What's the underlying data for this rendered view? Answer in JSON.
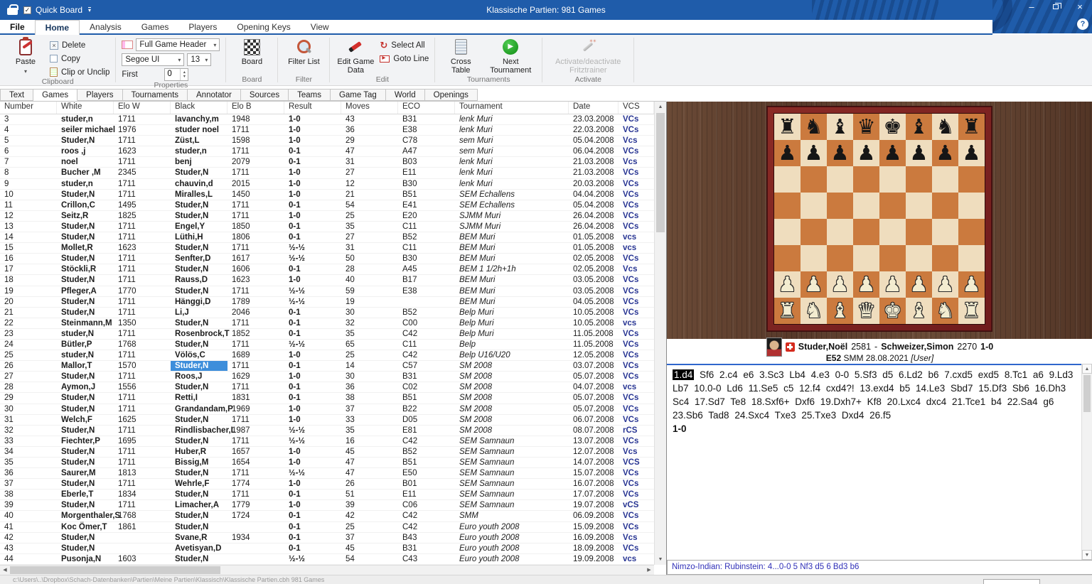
{
  "window": {
    "quick_board": "Quick Board",
    "center_title": "Klassische Partien:  981 Games",
    "minimize": "–",
    "close": "×",
    "help": "?"
  },
  "menu": {
    "file": "File",
    "tabs": [
      "Home",
      "Analysis",
      "Games",
      "Players",
      "Opening Keys",
      "View"
    ],
    "active": "Home"
  },
  "ribbon": {
    "paste": "Paste",
    "delete": "Delete",
    "copy": "Copy",
    "clip_or_unclip": "Clip or Unclip",
    "clipboard_label": "Clipboard",
    "full_game_header": "Full Game Header",
    "font_name": "Segoe UI",
    "font_size": "13",
    "first_label": "First",
    "first_value": "0",
    "properties_label": "Properties",
    "board_btn": "Board",
    "board_label": "Board",
    "filter_list": "Filter List",
    "filter_label": "Filter",
    "edit_game_data": "Edit Game Data",
    "select_all": "Select All",
    "goto_line": "Goto Line",
    "edit_label": "Edit",
    "cross_table": "Cross Table",
    "next_tournament": "Next Tournament",
    "tournaments_label": "Tournaments",
    "fritztrainer": "Activate/deactivate Fritztrainer",
    "activate_label": "Activate"
  },
  "view_tabs": {
    "items": [
      "Text",
      "Games",
      "Players",
      "Tournaments",
      "Annotator",
      "Sources",
      "Teams",
      "Game Tag",
      "World",
      "Openings"
    ],
    "active": "Games"
  },
  "table": {
    "columns": [
      "Number",
      "White",
      "Elo W",
      "Black",
      "Elo B",
      "Result",
      "Moves",
      "ECO",
      "Tournament",
      "Date",
      "VCS"
    ],
    "selected": {
      "row": "26",
      "col": 3
    },
    "rows": [
      [
        "3",
        "studer,n",
        "1711",
        "lavanchy,m",
        "1948",
        "1-0",
        "43",
        "B31",
        "lenk Muri",
        "23.03.2008",
        "VCs"
      ],
      [
        "4",
        "seiler michael",
        "1976",
        "studer noel",
        "1711",
        "1-0",
        "36",
        "E38",
        "lenk Muri",
        "22.03.2008",
        "VCs"
      ],
      [
        "5",
        "Studer,N",
        "1711",
        "Züst,L",
        "1598",
        "1-0",
        "29",
        "C78",
        "sem Muri",
        "05.04.2008",
        "Vcs"
      ],
      [
        "6",
        "roos ,j",
        "1623",
        "studer,n",
        "1711",
        "0-1",
        "47",
        "A47",
        "sem Muri",
        "06.04.2008",
        "VCs"
      ],
      [
        "7",
        "noel",
        "1711",
        "benj",
        "2079",
        "0-1",
        "31",
        "B03",
        "lenk Muri",
        "21.03.2008",
        "Vcs"
      ],
      [
        "8",
        "Bucher ,M",
        "2345",
        "Studer,N",
        "1711",
        "1-0",
        "27",
        "E11",
        "lenk Muri",
        "21.03.2008",
        "VCs"
      ],
      [
        "9",
        "studer,n",
        "1711",
        "chauvin,d",
        "2015",
        "1-0",
        "12",
        "B30",
        "lenk Muri",
        "20.03.2008",
        "VCs"
      ],
      [
        "10",
        "Studer,N",
        "1711",
        "Miralles,L",
        "1450",
        "1-0",
        "21",
        "B51",
        "SEM Echallens",
        "04.04.2008",
        "VCs"
      ],
      [
        "11",
        "Crillon,C",
        "1495",
        "Studer,N",
        "1711",
        "0-1",
        "54",
        "E41",
        "SEM Echallens",
        "05.04.2008",
        "VCs"
      ],
      [
        "12",
        "Seitz,R",
        "1825",
        "Studer,N",
        "1711",
        "1-0",
        "25",
        "E20",
        "SJMM Muri",
        "26.04.2008",
        "VCs"
      ],
      [
        "13",
        "Studer,N",
        "1711",
        "Engel,Y",
        "1850",
        "0-1",
        "35",
        "C11",
        "SJMM Muri",
        "26.04.2008",
        "VCs"
      ],
      [
        "14",
        "Studer,N",
        "1711",
        "Lüthi,H",
        "1806",
        "0-1",
        "27",
        "B52",
        "BEM Muri",
        "01.05.2008",
        "vcs"
      ],
      [
        "15",
        "Mollet,R",
        "1623",
        "Studer,N",
        "1711",
        "½-½",
        "31",
        "C11",
        "BEM Muri",
        "01.05.2008",
        "vcs"
      ],
      [
        "16",
        "Studer,N",
        "1711",
        "Senfter,D",
        "1617",
        "½-½",
        "50",
        "B30",
        "BEM Muri",
        "02.05.2008",
        "VCs"
      ],
      [
        "17",
        "Stöckli,R",
        "1711",
        "Studer,N",
        "1606",
        "0-1",
        "28",
        "A45",
        "BEM 1 1/2h+1h",
        "02.05.2008",
        "Vcs"
      ],
      [
        "18",
        "Studer,N",
        "1711",
        "Rauss,D",
        "1623",
        "1-0",
        "40",
        "B17",
        "BEM Muri",
        "03.05.2008",
        "VCs"
      ],
      [
        "19",
        "Pfleger,A",
        "1770",
        "Studer,N",
        "1711",
        "½-½",
        "59",
        "E38",
        "BEM Muri",
        "03.05.2008",
        "VCs"
      ],
      [
        "20",
        "Studer,N",
        "1711",
        "Hänggi,D",
        "1789",
        "½-½",
        "19",
        "",
        "BEM Muri",
        "04.05.2008",
        "VCs"
      ],
      [
        "21",
        "Studer,N",
        "1711",
        "Li,J",
        "2046",
        "0-1",
        "30",
        "B52",
        "Belp Muri",
        "10.05.2008",
        "VCs"
      ],
      [
        "22",
        "Steinmann,M",
        "1350",
        "Studer,N",
        "1711",
        "0-1",
        "32",
        "C00",
        "Belp Muri",
        "10.05.2008",
        "vcs"
      ],
      [
        "23",
        "studer,N",
        "1711",
        "Rosenbrock,T",
        "1852",
        "0-1",
        "35",
        "C42",
        "Belp Muri",
        "11.05.2008",
        "VCs"
      ],
      [
        "24",
        "Bütler,P",
        "1768",
        "Studer,N",
        "1711",
        "½-½",
        "65",
        "C11",
        "Belp",
        "11.05.2008",
        "VCs"
      ],
      [
        "25",
        "studer,N",
        "1711",
        "Völös,C",
        "1689",
        "1-0",
        "25",
        "C42",
        "Belp U16/U20",
        "12.05.2008",
        "VCs"
      ],
      [
        "26",
        "Mallor,T",
        "1570",
        "Studer,N",
        "1711",
        "0-1",
        "14",
        "C57",
        "SM 2008",
        "03.07.2008",
        "VCs"
      ],
      [
        "27",
        "Studer,N",
        "1711",
        "Roos,J",
        "1629",
        "1-0",
        "30",
        "B31",
        "SM 2008",
        "05.07.2008",
        "VCs"
      ],
      [
        "28",
        "Aymon,J",
        "1556",
        "Studer,N",
        "1711",
        "0-1",
        "36",
        "C02",
        "SM 2008",
        "04.07.2008",
        "vcs"
      ],
      [
        "29",
        "Studer,N",
        "1711",
        "Retti,I",
        "1831",
        "0-1",
        "38",
        "B51",
        "SM 2008",
        "05.07.2008",
        "VCs"
      ],
      [
        "30",
        "Studer,N",
        "1711",
        "Grandandam,P",
        "1969",
        "1-0",
        "37",
        "B22",
        "SM 2008",
        "05.07.2008",
        "VCs"
      ],
      [
        "31",
        "Welch,F",
        "1625",
        "Studer,N",
        "1711",
        "1-0",
        "33",
        "D05",
        "SM 2008",
        "06.07.2008",
        "VCs"
      ],
      [
        "32",
        "Studer,N",
        "1711",
        "Rindlisbacher,L",
        "1987",
        "½-½",
        "35",
        "E81",
        "SM 2008",
        "08.07.2008",
        "rCS"
      ],
      [
        "33",
        "Fiechter,P",
        "1695",
        "Studer,N",
        "1711",
        "½-½",
        "16",
        "C42",
        "SEM Samnaun",
        "13.07.2008",
        "VCs"
      ],
      [
        "34",
        "Studer,N",
        "1711",
        "Huber,R",
        "1657",
        "1-0",
        "45",
        "B52",
        "SEM Samnaun",
        "12.07.2008",
        "Vcs"
      ],
      [
        "35",
        "Studer,N",
        "1711",
        "Bissig,M",
        "1654",
        "1-0",
        "47",
        "B51",
        "SEM Samnaun",
        "14.07.2008",
        "VCS"
      ],
      [
        "36",
        "Saurer,M",
        "1813",
        "Studer,N",
        "1711",
        "½-½",
        "47",
        "E50",
        "SEM Samnaun",
        "15.07.2008",
        "VCs"
      ],
      [
        "37",
        "Studer,N",
        "1711",
        "Wehrle,F",
        "1774",
        "1-0",
        "26",
        "B01",
        "SEM Samnaun",
        "16.07.2008",
        "VCs"
      ],
      [
        "38",
        "Eberle,T",
        "1834",
        "Studer,N",
        "1711",
        "0-1",
        "51",
        "E11",
        "SEM Samnaun",
        "17.07.2008",
        "VCs"
      ],
      [
        "39",
        "Studer,N",
        "1711",
        "Limacher,A",
        "1779",
        "1-0",
        "39",
        "C06",
        "SEM Samnaun",
        "19.07.2008",
        "vCS"
      ],
      [
        "40",
        "Morgenthaler,S",
        "1768",
        "Studer,N",
        "1724",
        "0-1",
        "42",
        "C42",
        "SMM",
        "06.09.2008",
        "VCs"
      ],
      [
        "41",
        "Koc Ömer,T",
        "1861",
        "Studer,N",
        "",
        "0-1",
        "25",
        "C42",
        "Euro youth 2008",
        "15.09.2008",
        "VCs"
      ],
      [
        "42",
        "Studer,N",
        "",
        "Svane,R",
        "1934",
        "0-1",
        "37",
        "B43",
        "Euro youth 2008",
        "16.09.2008",
        "Vcs"
      ],
      [
        "43",
        "Studer,N",
        "",
        "Avetisyan,D",
        "",
        "0-1",
        "45",
        "B31",
        "Euro youth 2008",
        "18.09.2008",
        "VCs"
      ],
      [
        "44",
        "Pusonja,N",
        "1603",
        "Studer,N",
        "",
        "½-½",
        "54",
        "C43",
        "Euro youth 2008",
        "19.09.2008",
        "vcs"
      ]
    ]
  },
  "board": {
    "rows": [
      "rnbqkbnr",
      "pppppppp",
      "        ",
      "        ",
      "        ",
      "        ",
      "PPPPPPPP",
      "RNBQKBNR"
    ]
  },
  "game": {
    "white": "Studer,Noël",
    "white_elo": "2581",
    "separator": "-",
    "black": "Schweizer,Simon",
    "black_elo": "2270",
    "result": "1-0",
    "eco": "E52",
    "event_date": "SMM 28.08.2021",
    "user": "[User]"
  },
  "notation": {
    "first": "1.d4",
    "moves": "Sf6 2.c4 e6 3.Sc3 Lb4 4.e3 0-0 5.Sf3 d5 6.Ld2 b6 7.cxd5 exd5 8.Tc1 a6 9.Ld3 Lb7 10.0-0 Ld6 11.Se5 c5 12.f4 cxd4?! 13.exd4 b5 14.Le3 Sbd7 15.Df3 Sb6 16.Dh3 Sc4 17.Sd7 Te8 18.Sxf6+ Dxf6 19.Dxh7+ Kf8 20.Lxc4 dxc4 21.Tce1 b4 22.Sa4 g6 23.Sb6 Tad8 24.Sxc4 Txe3 25.Txe3 Dxd4 26.f5",
    "result": "1-0"
  },
  "opening": {
    "text": "Nimzo-Indian: Rubinstein: 4...0-0 5 Nf3 d5 6 Bd3 b6"
  },
  "status": {
    "path": "c:\\Users\\..\\Dropbox\\Schach-Datenbanken\\Partien\\Meine Partien\\Klassisch\\Klassische Partien.cbh  981 Games"
  }
}
